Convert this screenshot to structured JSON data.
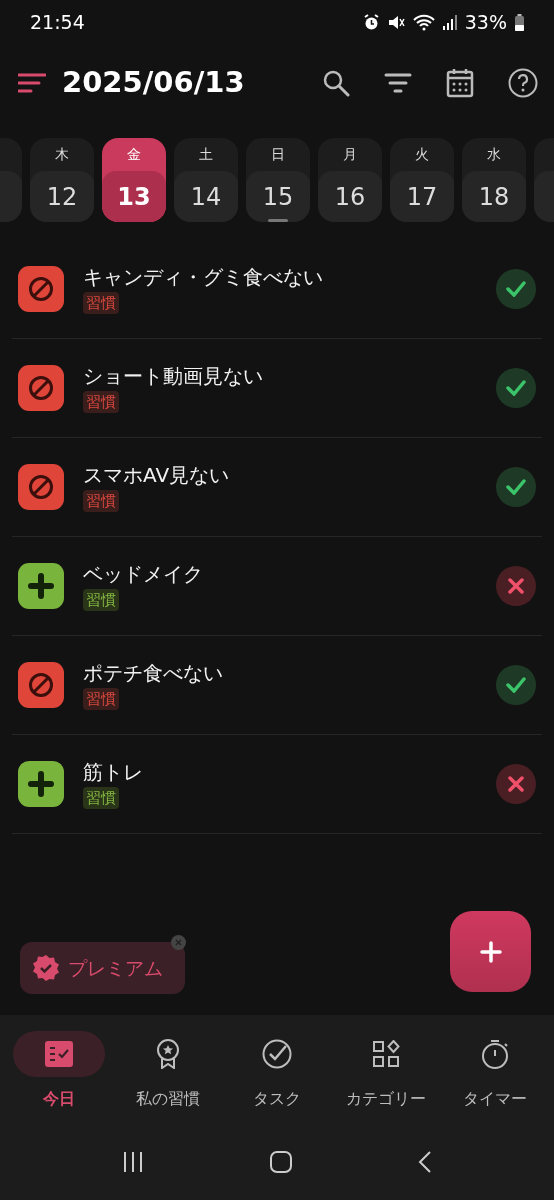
{
  "status_bar": {
    "time": "21:54",
    "battery": "33%"
  },
  "header": {
    "title": "2025/06/13"
  },
  "days": [
    {
      "weekday": "木",
      "day": "12",
      "selected": false,
      "today": false
    },
    {
      "weekday": "金",
      "day": "13",
      "selected": true,
      "today": false
    },
    {
      "weekday": "土",
      "day": "14",
      "selected": false,
      "today": false
    },
    {
      "weekday": "日",
      "day": "15",
      "selected": false,
      "today": true
    },
    {
      "weekday": "月",
      "day": "16",
      "selected": false,
      "today": false
    },
    {
      "weekday": "火",
      "day": "17",
      "selected": false,
      "today": false
    },
    {
      "weekday": "水",
      "day": "18",
      "selected": false,
      "today": false
    }
  ],
  "habits": [
    {
      "kind": "avoid",
      "name": "キャンディ・グミ食べない",
      "tag": "習慣",
      "done": true
    },
    {
      "kind": "avoid",
      "name": "ショート動画見ない",
      "tag": "習慣",
      "done": true
    },
    {
      "kind": "avoid",
      "name": "スマホAV見ない",
      "tag": "習慣",
      "done": true
    },
    {
      "kind": "build",
      "name": "ベッドメイク",
      "tag": "習慣",
      "done": false
    },
    {
      "kind": "avoid",
      "name": "ポテチ食べない",
      "tag": "習慣",
      "done": true
    },
    {
      "kind": "build",
      "name": "筋トレ",
      "tag": "習慣",
      "done": false
    }
  ],
  "premium_chip": {
    "label": "プレミアム"
  },
  "bottom_nav": [
    {
      "label": "今日",
      "selected": true
    },
    {
      "label": "私の習慣",
      "selected": false
    },
    {
      "label": "タスク",
      "selected": false
    },
    {
      "label": "カテゴリー",
      "selected": false
    },
    {
      "label": "タイマー",
      "selected": false
    }
  ]
}
